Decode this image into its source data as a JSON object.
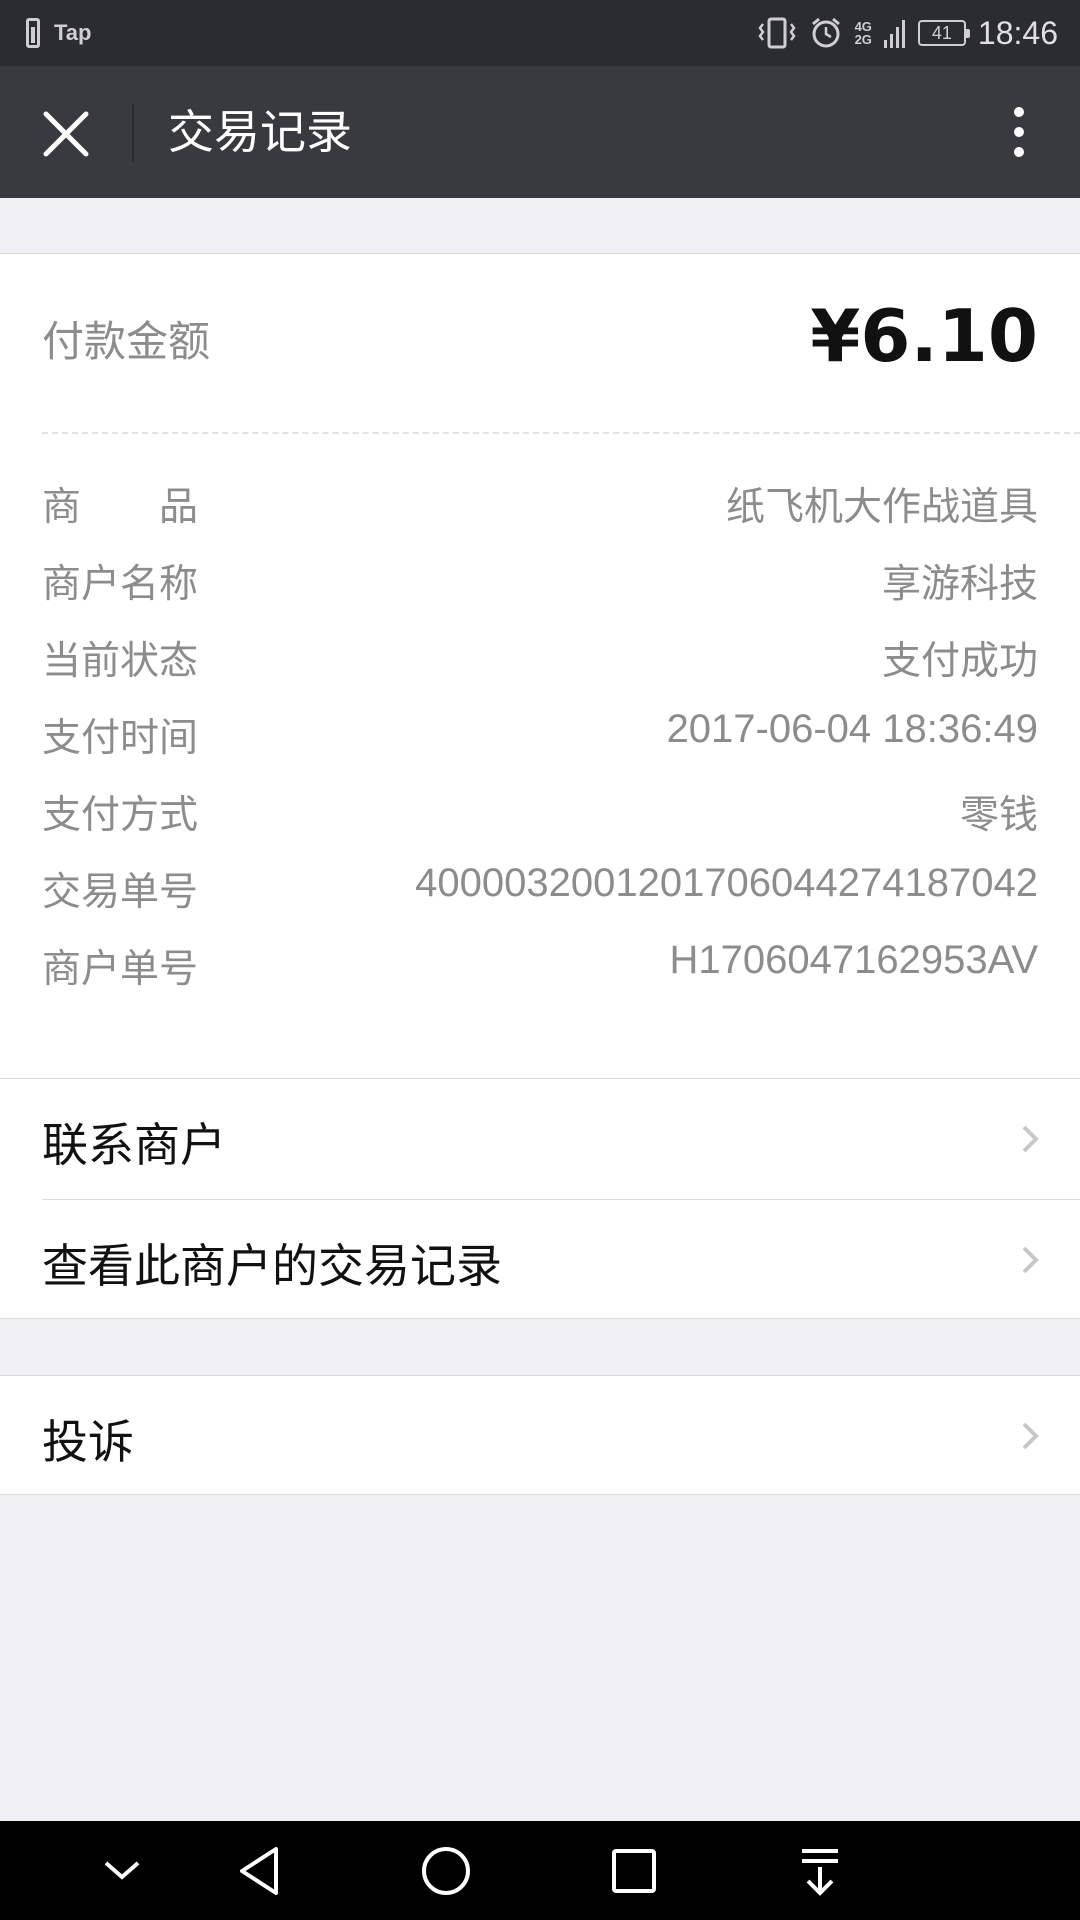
{
  "status_bar": {
    "app_name": "Tap",
    "network_top": "4G",
    "network_bottom": "2G",
    "battery": "41",
    "time": "18:46"
  },
  "nav": {
    "title": "交易记录"
  },
  "amount": {
    "label": "付款金额",
    "value": "¥6.10"
  },
  "details": [
    {
      "label": "商　　品",
      "value": "纸飞机大作战道具"
    },
    {
      "label": "商户名称",
      "value": "享游科技"
    },
    {
      "label": "当前状态",
      "value": "支付成功"
    },
    {
      "label": "支付时间",
      "value": "2017-06-04 18:36:49"
    },
    {
      "label": "支付方式",
      "value": "零钱"
    },
    {
      "label": "交易单号",
      "value": "4000032001201706044274187042"
    },
    {
      "label": "商户单号",
      "value": "H1706047162953AV"
    }
  ],
  "links": {
    "contact_merchant": "联系商户",
    "view_merchant_records": "查看此商户的交易记录",
    "complaint": "投诉"
  },
  "colors": {
    "nav_bg": "#393a3f",
    "status_bg": "#2b2c30",
    "page_bg": "#efeff4",
    "label_gray": "#8c8c8c"
  },
  "icons": {
    "close": "close-icon",
    "more": "more-vertical-icon",
    "chevron": "chevron-right-icon",
    "sys_down": "chevron-down-icon",
    "sys_back": "back-triangle-icon",
    "sys_home": "home-circle-icon",
    "sys_recent": "recent-square-icon",
    "sys_notify": "notification-pull-icon"
  }
}
